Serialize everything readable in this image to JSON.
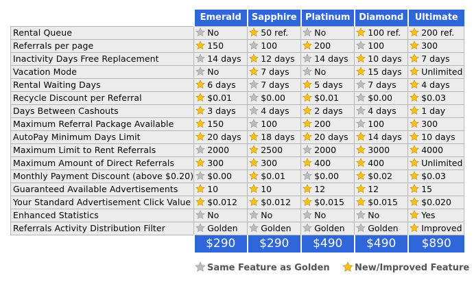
{
  "colors": {
    "header_bg": "#2f67db",
    "row_bg": "#ececec",
    "star_gold": "#f6c11c",
    "star_gray": "#bdbdbd"
  },
  "plans": [
    "Emerald",
    "Sapphire",
    "Platinum",
    "Diamond",
    "Ultimate"
  ],
  "rows": [
    {
      "feature": "Rental Queue",
      "cells": [
        [
          "gray",
          "No"
        ],
        [
          "gold",
          "50 ref."
        ],
        [
          "gray",
          "No"
        ],
        [
          "gold",
          "100 ref."
        ],
        [
          "gold",
          "200 ref."
        ]
      ]
    },
    {
      "feature": "Referrals per page",
      "cells": [
        [
          "gold",
          "150"
        ],
        [
          "gray",
          "100"
        ],
        [
          "gold",
          "200"
        ],
        [
          "gray",
          "100"
        ],
        [
          "gold",
          "300"
        ]
      ]
    },
    {
      "feature": "Inactivity Days Free Replacement",
      "cells": [
        [
          "gray",
          "14 days"
        ],
        [
          "gold",
          "12 days"
        ],
        [
          "gray",
          "14 days"
        ],
        [
          "gold",
          "10 days"
        ],
        [
          "gold",
          "7 days"
        ]
      ]
    },
    {
      "feature": "Vacation Mode",
      "cells": [
        [
          "gray",
          "No"
        ],
        [
          "gold",
          "7 days"
        ],
        [
          "gray",
          "No"
        ],
        [
          "gold",
          "15 days"
        ],
        [
          "gold",
          "Unlimited"
        ]
      ]
    },
    {
      "feature": "Rental Waiting Days",
      "cells": [
        [
          "gold",
          "6 days"
        ],
        [
          "gray",
          "7 days"
        ],
        [
          "gold",
          "5 days"
        ],
        [
          "gray",
          "7 days"
        ],
        [
          "gold",
          "4 days"
        ]
      ]
    },
    {
      "feature": "Recycle Discount per Referral",
      "cells": [
        [
          "gold",
          "$0.01"
        ],
        [
          "gray",
          "$0.00"
        ],
        [
          "gold",
          "$0.01"
        ],
        [
          "gray",
          "$0.00"
        ],
        [
          "gold",
          "$0.03"
        ]
      ]
    },
    {
      "feature": "Days Between Cashouts",
      "cells": [
        [
          "gold",
          "3 days"
        ],
        [
          "gray",
          "4 days"
        ],
        [
          "gold",
          "2 days"
        ],
        [
          "gray",
          "4 days"
        ],
        [
          "gold",
          "1 day"
        ]
      ]
    },
    {
      "feature": "Maximum Referral Package Available",
      "cells": [
        [
          "gold",
          "150"
        ],
        [
          "gray",
          "100"
        ],
        [
          "gold",
          "200"
        ],
        [
          "gray",
          "100"
        ],
        [
          "gold",
          "300"
        ]
      ]
    },
    {
      "feature": "AutoPay Minimum Days Limit",
      "cells": [
        [
          "gold",
          "20 days"
        ],
        [
          "gold",
          "18 days"
        ],
        [
          "gold",
          "20 days"
        ],
        [
          "gold",
          "14 days"
        ],
        [
          "gold",
          "10 days"
        ]
      ]
    },
    {
      "feature": "Maximum Limit to Rent Referrals",
      "cells": [
        [
          "gray",
          "2000"
        ],
        [
          "gold",
          "2500"
        ],
        [
          "gray",
          "2000"
        ],
        [
          "gold",
          "3000"
        ],
        [
          "gold",
          "4000"
        ]
      ]
    },
    {
      "feature": "Maximum Amount of Direct Referrals",
      "cells": [
        [
          "gold",
          "300"
        ],
        [
          "gold",
          "300"
        ],
        [
          "gold",
          "400"
        ],
        [
          "gold",
          "400"
        ],
        [
          "gold",
          "Unlimited"
        ]
      ]
    },
    {
      "feature": "Monthly Payment Discount (above $0.20)",
      "cells": [
        [
          "gray",
          "$0.00"
        ],
        [
          "gold",
          "$0.01"
        ],
        [
          "gray",
          "$0.00"
        ],
        [
          "gold",
          "$0.02"
        ],
        [
          "gold",
          "$0.03"
        ]
      ]
    },
    {
      "feature": "Guaranteed Available Advertisements",
      "cells": [
        [
          "gold",
          "10"
        ],
        [
          "gold",
          "10"
        ],
        [
          "gold",
          "12"
        ],
        [
          "gold",
          "12"
        ],
        [
          "gold",
          "15"
        ]
      ]
    },
    {
      "feature": "Your Standard Advertisement Click Value",
      "cells": [
        [
          "gold",
          "$0.012"
        ],
        [
          "gold",
          "$0.012"
        ],
        [
          "gold",
          "$0.015"
        ],
        [
          "gold",
          "$0.015"
        ],
        [
          "gold",
          "$0.020"
        ]
      ]
    },
    {
      "feature": "Enhanced Statistics",
      "cells": [
        [
          "gray",
          "No"
        ],
        [
          "gray",
          "No"
        ],
        [
          "gray",
          "No"
        ],
        [
          "gray",
          "No"
        ],
        [
          "gold",
          "Yes"
        ]
      ]
    },
    {
      "feature": "Referrals Activity Distribution Filter",
      "cells": [
        [
          "gray",
          "Golden"
        ],
        [
          "gray",
          "Golden"
        ],
        [
          "gray",
          "Golden"
        ],
        [
          "gray",
          "Golden"
        ],
        [
          "gold",
          "Improved"
        ]
      ]
    }
  ],
  "prices": [
    "$290",
    "$290",
    "$490",
    "$490",
    "$890"
  ],
  "legend": {
    "same_label": "Same Feature as Golden",
    "new_label": "New/Improved Feature",
    "same_icon": "gray-star-icon",
    "new_icon": "gold-star-icon"
  }
}
